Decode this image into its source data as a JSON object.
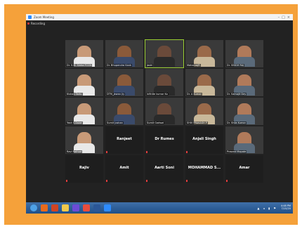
{
  "window": {
    "title": "Zoom Meeting",
    "controls": [
      "–",
      "□",
      "×"
    ]
  },
  "recording": {
    "label": "Recording"
  },
  "participants": [
    {
      "name": "Dr. S.M. Sinha FCCN",
      "video": true
    },
    {
      "name": "Dr. Bhupendra Kank",
      "video": true
    },
    {
      "name": "Jashi",
      "video": true,
      "active": true
    },
    {
      "name": "MohanrajR",
      "video": true
    },
    {
      "name": "Dr. SINGH RAJ",
      "video": true
    },
    {
      "name": "Kishan Tartu",
      "video": true
    },
    {
      "name": "DTM_Jewan Jiy",
      "video": true
    },
    {
      "name": "infinite kumar Ko",
      "video": true
    },
    {
      "name": "Dr. A Kumar",
      "video": true
    },
    {
      "name": "Dr. Samojit Dey",
      "video": true
    },
    {
      "name": "Yash S Dube",
      "video": true
    },
    {
      "name": "Sumit Joshan",
      "video": true
    },
    {
      "name": "Sumit Gadwal",
      "video": true
    },
    {
      "name": "SHIV PRAKASH P",
      "video": true
    },
    {
      "name": "Dr. Shila Kumar",
      "video": true
    },
    {
      "name": "Ravi Rathod",
      "video": true
    },
    {
      "name": "Ranjeet",
      "video": false
    },
    {
      "name": "Dr Rumes",
      "video": false
    },
    {
      "name": "Anjali Singh",
      "video": false
    },
    {
      "name": "Prasant Mapate",
      "video": true
    },
    {
      "name": "Rajiv",
      "video": false
    },
    {
      "name": "Amit",
      "video": false
    },
    {
      "name": "Aarti Soni",
      "video": false
    },
    {
      "name": "MOHAMMAD S...",
      "video": false
    },
    {
      "name": "Amar",
      "video": false
    }
  ],
  "taskbar": {
    "icons": [
      "start-orb-icon",
      "firefox-icon",
      "powerpoint-icon",
      "folder-icon",
      "media-icon",
      "chrome-icon",
      "word-icon",
      "zoom-icon"
    ],
    "icon_colors": [
      "#4ea1e6",
      "#e86a1c",
      "#d04423",
      "#f2c84b",
      "#6c4bd6",
      "#e84c3d",
      "#2b5797",
      "#2d8cff"
    ],
    "time": "4:48 PM",
    "date": "7/15/20"
  }
}
